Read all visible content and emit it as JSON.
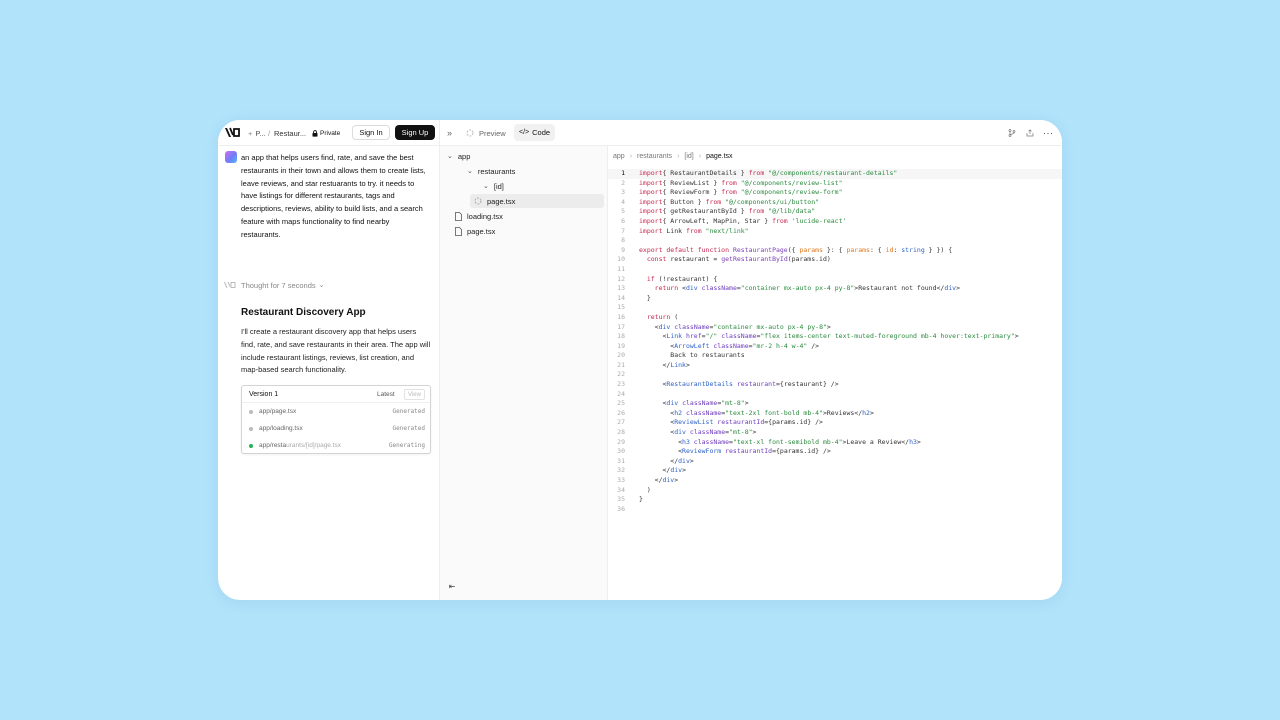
{
  "topbar": {
    "project_short": "P...",
    "breadcrumb_sep": "/",
    "chat_name": "Restaur...",
    "visibility": "Private",
    "sign_in": "Sign In",
    "sign_up": "Sign Up",
    "tab_preview": "Preview",
    "tab_code": "Code"
  },
  "chat": {
    "prompt": "an app that helps users find, rate, and save the best restaurants in their town and allows them to create lists, leave reviews, and star restuarants to try. it needs to have listings for different restaurants, tags and descriptions, reviews, ability to build lists, and a search feature with maps functionality to find nearby restaurants.",
    "thought": "Thought for 7 seconds",
    "heading": "Restaurant Discovery App",
    "paragraph": "I'll create a restaurant discovery app that helps users find, rate, and save restaurants in their area. The app will include restaurant listings, reviews, list creation, and map-based search functionality.",
    "version": {
      "title": "Version 1",
      "latest": "Latest",
      "view": "View",
      "files": [
        {
          "path": "app/page.tsx",
          "status": "Generated"
        },
        {
          "path": "app/loading.tsx",
          "status": "Generated"
        },
        {
          "path_bright": "app/resta",
          "path_fade": "urants/[id]/page.tsx",
          "status": "Generating"
        }
      ]
    }
  },
  "tree": {
    "app": "app",
    "restaurants": "restaurants",
    "id": "[id]",
    "page_id": "page.tsx",
    "loading": "loading.tsx",
    "page": "page.tsx"
  },
  "editor": {
    "crumbs": [
      "app",
      "restaurants",
      "[id]",
      "page.tsx"
    ],
    "active_line": 1
  },
  "code_lines": [
    [
      [
        "kw",
        "import"
      ],
      [
        "",
        "{ RestaurantDetails } "
      ],
      [
        "kw",
        "from"
      ],
      [
        "",
        " "
      ],
      [
        "str",
        "\"@/components/restaurant-details\""
      ]
    ],
    [
      [
        "kw",
        "import"
      ],
      [
        "",
        "{ ReviewList } "
      ],
      [
        "kw",
        "from"
      ],
      [
        "",
        " "
      ],
      [
        "str",
        "\"@/components/review-list\""
      ]
    ],
    [
      [
        "kw",
        "import"
      ],
      [
        "",
        "{ ReviewForm } "
      ],
      [
        "kw",
        "from"
      ],
      [
        "",
        " "
      ],
      [
        "str",
        "\"@/components/review-form\""
      ]
    ],
    [
      [
        "kw",
        "import"
      ],
      [
        "",
        "{ Button } "
      ],
      [
        "kw",
        "from"
      ],
      [
        "",
        " "
      ],
      [
        "str",
        "\"@/components/ui/button\""
      ]
    ],
    [
      [
        "kw",
        "import"
      ],
      [
        "",
        "{ getRestaurantById } "
      ],
      [
        "kw",
        "from"
      ],
      [
        "",
        " "
      ],
      [
        "str",
        "\"@/lib/data\""
      ]
    ],
    [
      [
        "kw",
        "import"
      ],
      [
        "",
        "{ ArrowLeft, MapPin, Star } "
      ],
      [
        "kw",
        "from"
      ],
      [
        "",
        " "
      ],
      [
        "str",
        "'lucide-react'"
      ]
    ],
    [
      [
        "kw",
        "import"
      ],
      [
        "",
        " Link "
      ],
      [
        "kw",
        "from"
      ],
      [
        "",
        " "
      ],
      [
        "str",
        "\"next/link\""
      ]
    ],
    [],
    [
      [
        "kw",
        "export default function"
      ],
      [
        "",
        " "
      ],
      [
        "fn",
        "RestaurantPage"
      ],
      [
        "",
        "({ "
      ],
      [
        "par",
        "params"
      ],
      [
        "",
        " }: { "
      ],
      [
        "par",
        "params"
      ],
      [
        "",
        ": { "
      ],
      [
        "par",
        "id"
      ],
      [
        "",
        ": "
      ],
      [
        "typ",
        "string"
      ],
      [
        "",
        " } }) {"
      ]
    ],
    [
      [
        "",
        ""
      ],
      [
        "kw",
        "  const"
      ],
      [
        "",
        " restaurant = "
      ],
      [
        "fn",
        "getRestaurantById"
      ],
      [
        "",
        "(params.id)"
      ]
    ],
    [],
    [
      [
        "kw",
        "  if"
      ],
      [
        "",
        " (!restaurant) {"
      ]
    ],
    [
      [
        "kw",
        "    return"
      ],
      [
        "",
        " <"
      ],
      [
        "tag",
        "div"
      ],
      [
        "",
        " "
      ],
      [
        "attr",
        "className"
      ],
      [
        "",
        "="
      ],
      [
        "str",
        "\"container mx-auto px-4 py-8\""
      ],
      [
        "",
        ">Restaurant not found</"
      ],
      [
        "tag",
        "div"
      ],
      [
        "",
        ">"
      ]
    ],
    [
      [
        "",
        "  }"
      ]
    ],
    [],
    [
      [
        "kw",
        "  return"
      ],
      [
        "",
        " ("
      ]
    ],
    [
      [
        "",
        "    <"
      ],
      [
        "tag",
        "div"
      ],
      [
        "",
        " "
      ],
      [
        "attr",
        "className"
      ],
      [
        "",
        "="
      ],
      [
        "str",
        "\"container mx-auto px-4 py-8\""
      ],
      [
        "",
        ">"
      ]
    ],
    [
      [
        "",
        "      <"
      ],
      [
        "tag",
        "Link"
      ],
      [
        "",
        " "
      ],
      [
        "attr",
        "href"
      ],
      [
        "",
        "="
      ],
      [
        "str",
        "\"/\""
      ],
      [
        "",
        " "
      ],
      [
        "attr",
        "className"
      ],
      [
        "",
        "="
      ],
      [
        "str",
        "\"flex items-center text-muted-foreground mb-4 hover:text-primary\""
      ],
      [
        "",
        ">"
      ]
    ],
    [
      [
        "",
        "        <"
      ],
      [
        "tag",
        "ArrowLeft"
      ],
      [
        "",
        " "
      ],
      [
        "attr",
        "className"
      ],
      [
        "",
        "="
      ],
      [
        "str",
        "\"mr-2 h-4 w-4\""
      ],
      [
        "",
        " />"
      ]
    ],
    [
      [
        "",
        "        Back to restaurants"
      ]
    ],
    [
      [
        "",
        "      </"
      ],
      [
        "tag",
        "Link"
      ],
      [
        "",
        ">"
      ]
    ],
    [],
    [
      [
        "",
        "      <"
      ],
      [
        "tag",
        "RestaurantDetails"
      ],
      [
        "",
        " "
      ],
      [
        "attr",
        "restaurant"
      ],
      [
        "",
        "={restaurant} />"
      ]
    ],
    [],
    [
      [
        "",
        "      <"
      ],
      [
        "tag",
        "div"
      ],
      [
        "",
        " "
      ],
      [
        "attr",
        "className"
      ],
      [
        "",
        "="
      ],
      [
        "str",
        "\"mt-8\""
      ],
      [
        "",
        ">"
      ]
    ],
    [
      [
        "",
        "        <"
      ],
      [
        "tag",
        "h2"
      ],
      [
        "",
        " "
      ],
      [
        "attr",
        "className"
      ],
      [
        "",
        "="
      ],
      [
        "str",
        "\"text-2xl font-bold mb-4\""
      ],
      [
        "",
        ">Reviews</"
      ],
      [
        "tag",
        "h2"
      ],
      [
        "",
        ">"
      ]
    ],
    [
      [
        "",
        "        <"
      ],
      [
        "tag",
        "ReviewList"
      ],
      [
        "",
        " "
      ],
      [
        "attr",
        "restaurantId"
      ],
      [
        "",
        "={params.id} />"
      ]
    ],
    [
      [
        "",
        "        <"
      ],
      [
        "tag",
        "div"
      ],
      [
        "",
        " "
      ],
      [
        "attr",
        "className"
      ],
      [
        "",
        "="
      ],
      [
        "str",
        "\"mt-8\""
      ],
      [
        "",
        ">"
      ]
    ],
    [
      [
        "",
        "          <"
      ],
      [
        "tag",
        "h3"
      ],
      [
        "",
        " "
      ],
      [
        "attr",
        "className"
      ],
      [
        "",
        "="
      ],
      [
        "str",
        "\"text-xl font-semibold mb-4\""
      ],
      [
        "",
        ">Leave a Review</"
      ],
      [
        "tag",
        "h3"
      ],
      [
        "",
        ">"
      ]
    ],
    [
      [
        "",
        "          <"
      ],
      [
        "tag",
        "ReviewForm"
      ],
      [
        "",
        " "
      ],
      [
        "attr",
        "restaurantId"
      ],
      [
        "",
        "={params.id} />"
      ]
    ],
    [
      [
        "",
        "        </"
      ],
      [
        "tag",
        "div"
      ],
      [
        "",
        ">"
      ]
    ],
    [
      [
        "",
        "      </"
      ],
      [
        "tag",
        "div"
      ],
      [
        "",
        ">"
      ]
    ],
    [
      [
        "",
        "    </"
      ],
      [
        "tag",
        "div"
      ],
      [
        "",
        ">"
      ]
    ],
    [
      [
        "",
        "  )"
      ]
    ],
    [
      [
        "",
        "}"
      ]
    ],
    []
  ]
}
